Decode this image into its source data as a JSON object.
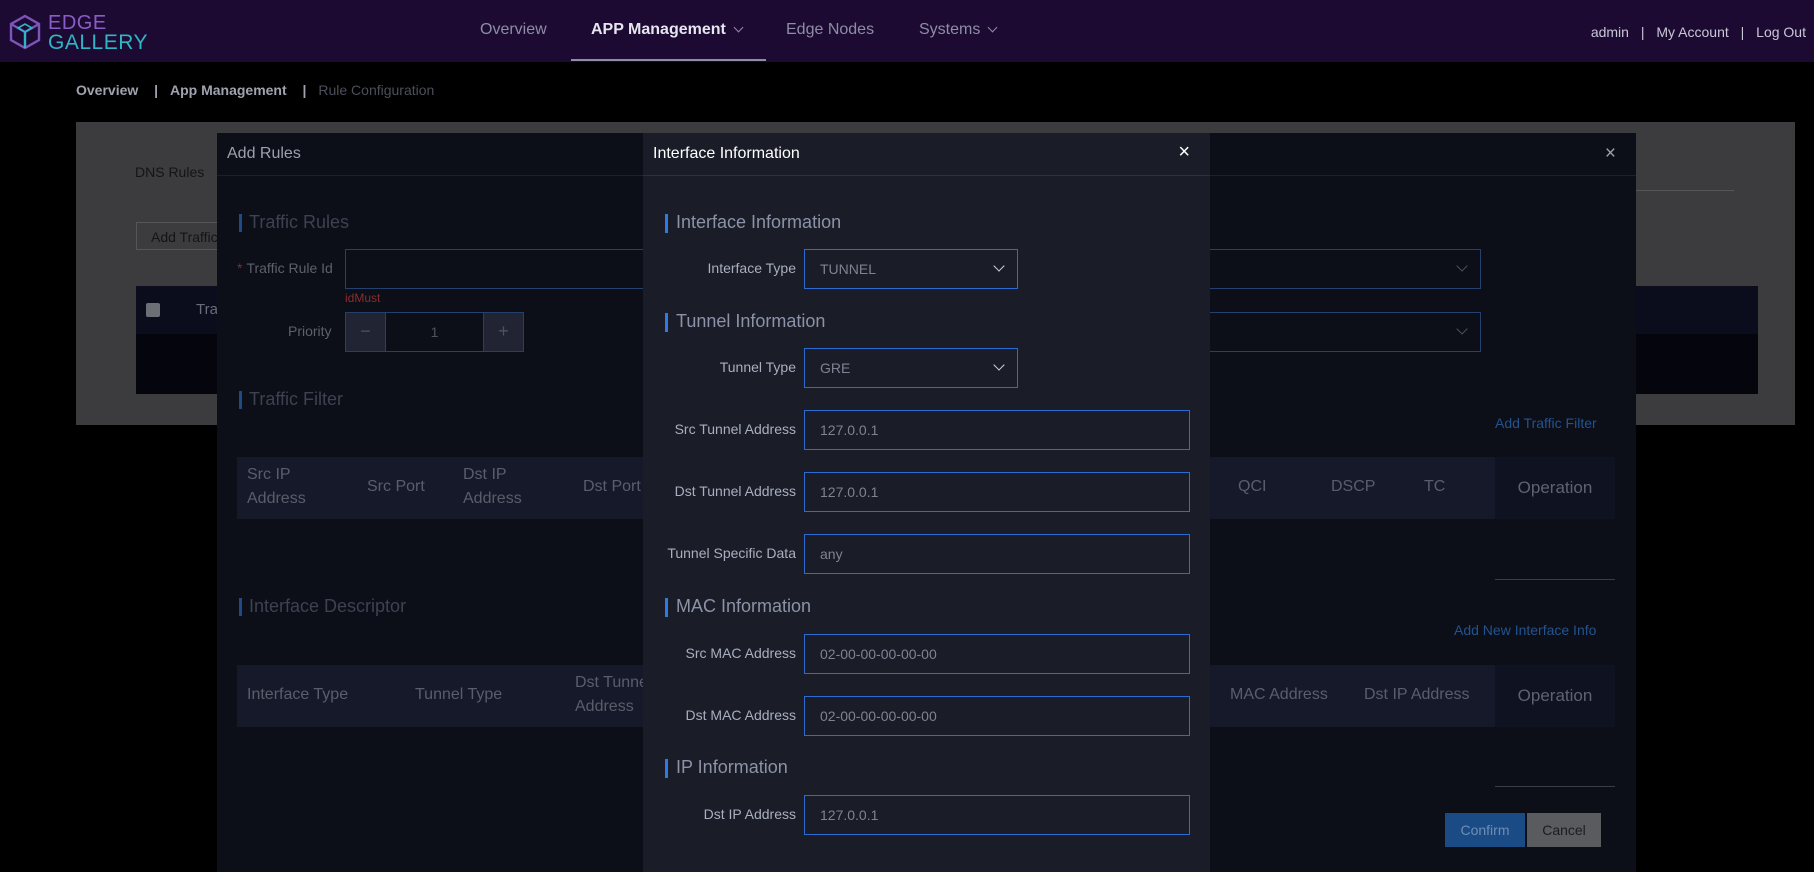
{
  "app": {
    "logo_line1": "EDGE",
    "logo_line2": "GALLERY"
  },
  "nav": {
    "items": [
      {
        "label": "Overview"
      },
      {
        "label": "APP Management"
      },
      {
        "label": "Edge Nodes"
      },
      {
        "label": "Systems"
      }
    ],
    "active": "APP Management"
  },
  "account": {
    "user": "admin",
    "my_account": "My Account",
    "logout": "Log Out",
    "separator": "|"
  },
  "breadcrumb": {
    "items": [
      "Overview",
      "App Management",
      "Rule Configuration"
    ],
    "separator": "|"
  },
  "background_page": {
    "tab": "DNS Rules",
    "add_button": "Add Traffic Rule",
    "table_first_header": "Traffic Rule Id"
  },
  "add_rules_dialog": {
    "title": "Add Rules",
    "close_icon": "×",
    "traffic_rules_title": "Traffic Rules",
    "traffic_rule_id_label": "Traffic Rule Id",
    "required_mark": "*",
    "id_error": "idMust",
    "priority_label": "Priority",
    "priority_value": "1",
    "minus": "−",
    "plus": "+",
    "traffic_filter_title": "Traffic Filter",
    "add_traffic_filter": "Add Traffic Filter",
    "traffic_filter_columns": [
      "Src IP Address",
      "Src Port",
      "Dst IP Address",
      "Dst Port",
      "QCI",
      "DSCP",
      "TC"
    ],
    "interface_descriptor_title": "Interface Descriptor",
    "add_interface_info": "Add New Interface Info",
    "interface_columns": [
      "Interface Type",
      "Tunnel Type",
      "Dst Tunnel Address",
      "MAC Address",
      "Dst IP Address"
    ],
    "operation": "Operation",
    "confirm": "Confirm",
    "cancel": "Cancel"
  },
  "interface_dialog": {
    "title": "Interface Information",
    "close_icon": "×",
    "sections": {
      "interface": "Interface Information",
      "tunnel": "Tunnel Information",
      "mac": "MAC Information",
      "ip": "IP Information"
    },
    "fields": {
      "interface_type": {
        "label": "Interface Type",
        "value": "TUNNEL"
      },
      "tunnel_type": {
        "label": "Tunnel Type",
        "value": "GRE"
      },
      "src_tunnel_address": {
        "label": "Src Tunnel Address",
        "value": "127.0.0.1"
      },
      "dst_tunnel_address": {
        "label": "Dst Tunnel Address",
        "value": "127.0.0.1"
      },
      "tunnel_specific_data": {
        "label": "Tunnel Specific Data",
        "value": "any"
      },
      "src_mac_address": {
        "label": "Src MAC Address",
        "value": "02-00-00-00-00-00"
      },
      "dst_mac_address": {
        "label": "Dst MAC Address",
        "value": "02-00-00-00-00-00"
      },
      "dst_ip_address": {
        "label": "Dst IP Address",
        "value": "127.0.0.1"
      }
    }
  },
  "colors": {
    "topbar": "#1d0a33",
    "accent_blue": "#2f7ae5",
    "logo_purple": "#8a5cc5",
    "logo_teal": "#2fb5c6",
    "error_red": "#8a2e2e"
  }
}
